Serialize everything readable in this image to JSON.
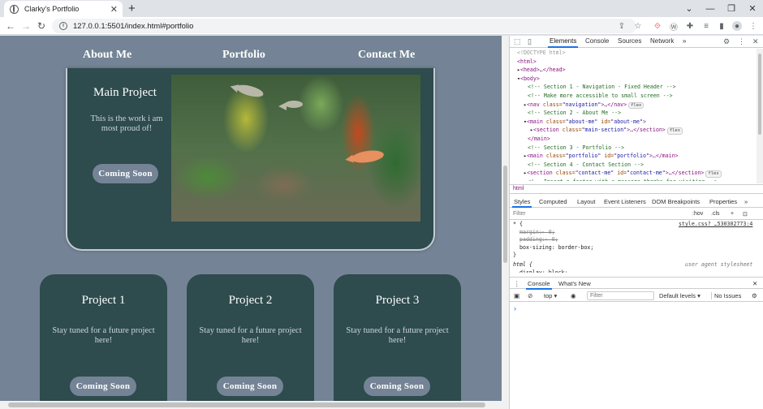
{
  "browser": {
    "tab_title": "Clarky's Portfolio",
    "tab_close": "✕",
    "new_tab": "+",
    "url": "127.0.0.1:5501/index.html#portfolio",
    "window_controls": [
      "⌄",
      "—",
      "❐",
      "✕"
    ]
  },
  "page": {
    "nav": [
      "About Me",
      "Portfolio",
      "Contact Me"
    ],
    "main_project": {
      "title": "Main Project",
      "description": "This is the work i am most proud of!",
      "button": "Coming Soon"
    },
    "projects": [
      {
        "title": "Project 1",
        "description": "Stay tuned for a future project here!",
        "button": "Coming Soon"
      },
      {
        "title": "Project 2",
        "description": "Stay tuned for a future project here!",
        "button": "Coming Soon"
      },
      {
        "title": "Project 3",
        "description": "Stay tuned for a future project here!",
        "button": "Coming Soon"
      }
    ]
  },
  "devtools": {
    "tabs": [
      "Elements",
      "Console",
      "Sources",
      "Network"
    ],
    "more": "»",
    "dom": {
      "doctype": "<!DOCTYPE html>",
      "html_open": "<html>",
      "head": "<head>…</head>",
      "body_open": "<body>",
      "c1": "<!-- Section 1 - Navigation - Fixed Header -->",
      "c2": "<!-- Make more accessible to small screen -->",
      "nav_tag": "<nav",
      "nav_attr": "class=",
      "nav_val": "\"navigation\"",
      "nav_rest": ">…</nav>",
      "c3": "<!-- Section 2 - About Me -->",
      "main1_tag": "<main",
      "main1_attr1": "class=",
      "main1_val1": "\"about-me\"",
      "main1_attr2": "id=",
      "main1_val2": "\"about-me\"",
      "section_tag": "<section",
      "section_attr": "class=",
      "section_val": "\"main-section\"",
      "section_rest": ">…</section>",
      "main_close": "</main>",
      "c4": "<!-- Section 3 - Portfolio -->",
      "main2_tag": "<main",
      "main2_attr1": "class=",
      "main2_val1": "\"portfolio\"",
      "main2_attr2": "id=",
      "main2_val2": "\"portfolio\"",
      "main2_rest": ">…</main>",
      "c5": "<!-- Section 4 - Contact Section -->",
      "sec2_tag": "<section",
      "sec2_attr1": "class=",
      "sec2_val1": "\"contact-me\"",
      "sec2_attr2": "id=",
      "sec2_val2": "\"contact-me\"",
      "sec2_rest": ">…</section>",
      "c6": "<!-- Insert a footer with a message thanks for visiting -->",
      "badge_flex": "flex"
    },
    "breadcrumb": "html",
    "subtabs": [
      "Styles",
      "Computed",
      "Layout",
      "Event Listeners",
      "DOM Breakpoints",
      "Properties"
    ],
    "filter_placeholder": "Filter",
    "filter_hov": ":hov",
    "filter_cls": ".cls",
    "filter_plus": "+",
    "styles": {
      "sel1": "* {",
      "source": "style.css?_…530302773:4",
      "p1": "margin:▸ 0;",
      "p2": "padding:▸ 0;",
      "p3": "box-sizing: border-box;",
      "close": "}",
      "sel2": "html {",
      "ua": "user agent stylesheet",
      "p4": "display: block;"
    },
    "drawer_tabs": [
      "Console",
      "What's New"
    ],
    "console_top": "top ▾",
    "console_filter": "Filter",
    "console_levels": "Default levels ▾",
    "console_issues": "No Issues",
    "console_prompt": "›"
  }
}
